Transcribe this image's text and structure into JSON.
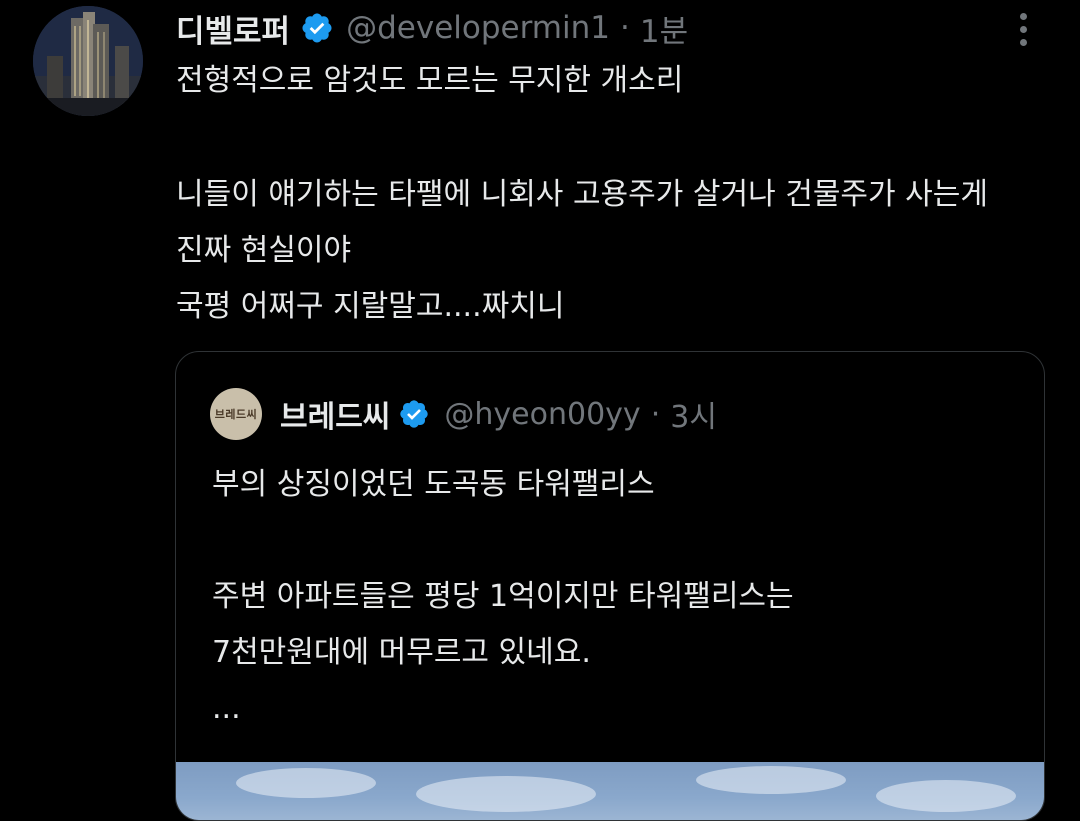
{
  "tweet": {
    "author": {
      "display_name": "디벨로퍼",
      "handle": "@developermin1",
      "separator": "·",
      "time": "1분",
      "verified_icon": "verified-badge-icon",
      "avatar_icon": "city-tower-night-icon"
    },
    "more_icon": "more-vertical-icon",
    "text_lines": [
      "전형적으로 암것도 모르는 무지한 개소리",
      "니들이 얘기하는 타팰에 니회사 고용주가 살거나 건물주가 사는게",
      "진짜 현실이야",
      "국평 어쩌구 지랄말고....짜치니"
    ]
  },
  "quote": {
    "author": {
      "display_name": "브레드씨",
      "handle": "@hyeon00yy",
      "separator": "·",
      "time": "3시",
      "verified_icon": "verified-badge-icon",
      "avatar_text": "브레드씨"
    },
    "text_lines": [
      "부의 상징이었던 도곡동 타워팰리스",
      "주변 아파트들은 평당 1억이지만 타워팰리스는",
      "7천만원대에 머무르고 있네요.",
      "..."
    ],
    "image_icon": "sky-photo-preview"
  },
  "colors": {
    "background": "#000000",
    "primary_text": "#e7e9ea",
    "secondary_text": "#71767b",
    "border": "#2f3336",
    "verified_blue": "#1d9bf0"
  }
}
